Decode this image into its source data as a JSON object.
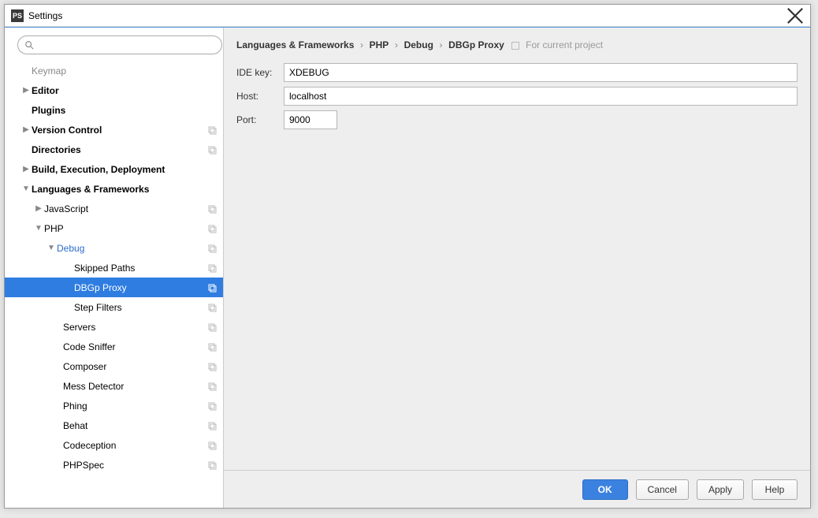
{
  "window": {
    "title": "Settings"
  },
  "breadcrumb": {
    "c1": "Languages & Frameworks",
    "c2": "PHP",
    "c3": "Debug",
    "c4": "DBGp Proxy",
    "sep": "›",
    "proj": "For current project"
  },
  "form": {
    "idekey_label": "IDE key:",
    "idekey_value": "XDEBUG",
    "host_label": "Host:",
    "host_value": "localhost",
    "port_label": "Port:",
    "port_value": "9000"
  },
  "buttons": {
    "ok": "OK",
    "cancel": "Cancel",
    "apply": "Apply",
    "help": "Help"
  },
  "tree": {
    "keymap": "Keymap",
    "editor": "Editor",
    "plugins": "Plugins",
    "vc": "Version Control",
    "dirs": "Directories",
    "bed": "Build, Execution, Deployment",
    "lf": "Languages & Frameworks",
    "js": "JavaScript",
    "php": "PHP",
    "debug": "Debug",
    "skipped": "Skipped Paths",
    "dbgp": "DBGp Proxy",
    "stepf": "Step Filters",
    "servers": "Servers",
    "sniffer": "Code Sniffer",
    "composer": "Composer",
    "mess": "Mess Detector",
    "phing": "Phing",
    "behat": "Behat",
    "codeception": "Codeception",
    "phpspec": "PHPSpec"
  },
  "arrows": {
    "right": "▶",
    "down": "▼"
  }
}
